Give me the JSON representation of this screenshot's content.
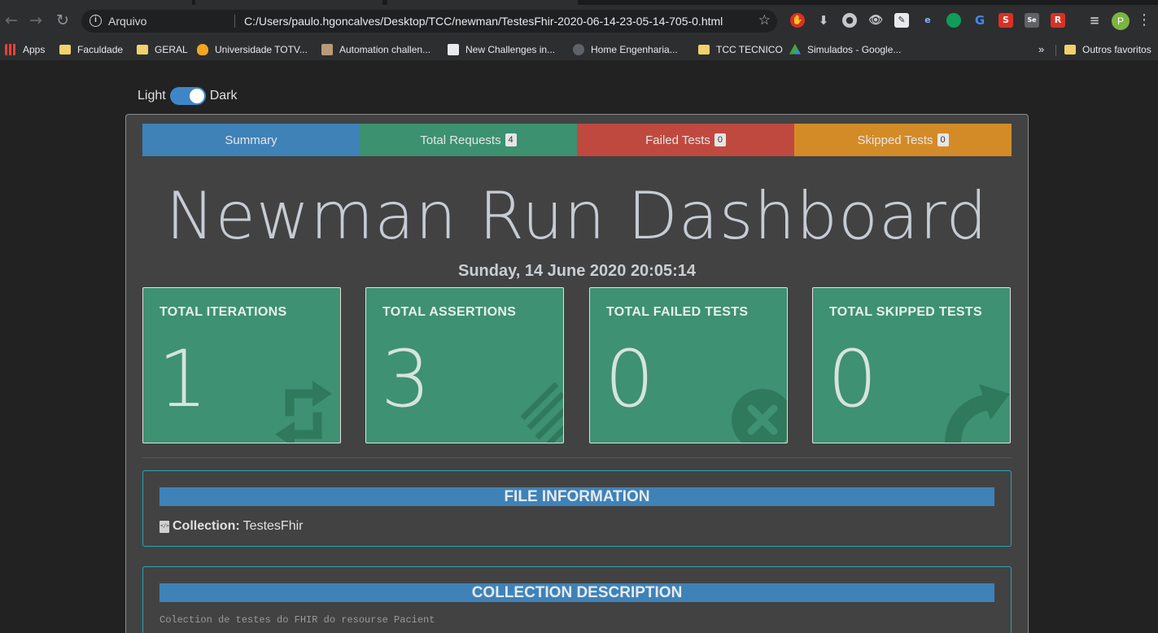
{
  "browser": {
    "scheme_label": "Arquivo",
    "url": "C:/Users/paulo.hgoncalves/Desktop/TCC/newman/TestesFhir-2020-06-14-23-05-14-705-0.html",
    "avatar_letter": "P",
    "bookmarks": [
      {
        "label": "Apps",
        "icon": "apps-grid-icon"
      },
      {
        "label": "Faculdade",
        "icon": "folder-icon"
      },
      {
        "label": "GERAL",
        "icon": "folder-icon"
      },
      {
        "label": "Universidade TOTV...",
        "icon": "flame-icon"
      },
      {
        "label": "Automation challen...",
        "icon": "avatar-icon"
      },
      {
        "label": "New Challenges in...",
        "icon": "page-icon"
      },
      {
        "label": "Home Engenharia...",
        "icon": "globe-icon"
      },
      {
        "label": "TCC TECNICO",
        "icon": "folder-icon"
      },
      {
        "label": "Simulados - Google...",
        "icon": "drive-icon"
      }
    ],
    "bookmarks_more": "»",
    "other_bookmarks": "Outros favoritos"
  },
  "theme_toggle": {
    "light_label": "Light",
    "dark_label": "Dark",
    "dark_enabled": true
  },
  "tabs": [
    {
      "label": "Summary",
      "badge": null
    },
    {
      "label": "Total Requests",
      "badge": "4"
    },
    {
      "label": "Failed Tests",
      "badge": "0"
    },
    {
      "label": "Skipped Tests",
      "badge": "0"
    }
  ],
  "dashboard": {
    "title": "Newman Run Dashboard",
    "date": "Sunday, 14 June 2020 20:05:14"
  },
  "cards": [
    {
      "label": "TOTAL ITERATIONS",
      "value": "1",
      "icon": "sync-icon"
    },
    {
      "label": "TOTAL ASSERTIONS",
      "value": "3",
      "icon": "list-icon"
    },
    {
      "label": "TOTAL FAILED TESTS",
      "value": "0",
      "icon": "times-circle-icon"
    },
    {
      "label": "TOTAL SKIPPED TESTS",
      "value": "0",
      "icon": "share-arrow-icon"
    }
  ],
  "file_info": {
    "header": "FILE INFORMATION",
    "collection_label": "Collection:",
    "collection_name": "TestesFhir"
  },
  "collection_description": {
    "header": "COLLECTION DESCRIPTION",
    "text": "Colection de testes do FHIR do resourse Pacient"
  },
  "colors": {
    "summary": "#3e82b8",
    "requests": "#3c9170",
    "failed": "#c0493f",
    "skipped": "#d38b27",
    "card": "#3e9172"
  }
}
